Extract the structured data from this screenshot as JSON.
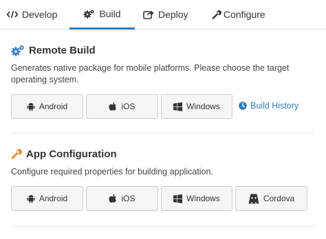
{
  "tabs": [
    {
      "label": "Develop",
      "icon": "code-icon"
    },
    {
      "label": "Build",
      "icon": "gears-icon"
    },
    {
      "label": "Deploy",
      "icon": "share-icon"
    },
    {
      "label": "Configure",
      "icon": "wrench-icon"
    }
  ],
  "active_tab": "Build",
  "remote_build": {
    "title": "Remote Build",
    "description": "Generates native package for mobile platforms. Please choose the target operating system.",
    "buttons": [
      {
        "label": "Android",
        "icon": "android-icon"
      },
      {
        "label": "iOS",
        "icon": "apple-icon"
      },
      {
        "label": "Windows",
        "icon": "windows-icon"
      }
    ],
    "history_link": "Build History"
  },
  "app_configuration": {
    "title": "App Configuration",
    "description": "Configure required properties for building application.",
    "buttons": [
      {
        "label": "Android",
        "icon": "android-icon"
      },
      {
        "label": "iOS",
        "icon": "apple-icon"
      },
      {
        "label": "Windows",
        "icon": "windows-icon"
      },
      {
        "label": "Cordova",
        "icon": "cordova-icon"
      }
    ]
  },
  "colors": {
    "accent": "#337ab7",
    "icon_blue": "#3a7fc1",
    "wrench_orange": "#e08a2c"
  }
}
